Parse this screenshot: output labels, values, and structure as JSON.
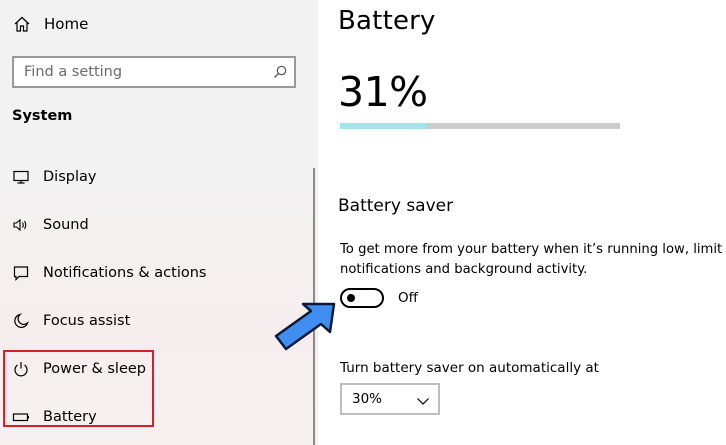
{
  "sidebar": {
    "home_label": "Home",
    "search_placeholder": "Find a setting",
    "section_title": "System",
    "items": [
      {
        "label": "Display",
        "icon": "monitor-icon"
      },
      {
        "label": "Sound",
        "icon": "speaker-icon"
      },
      {
        "label": "Notifications & actions",
        "icon": "notification-icon"
      },
      {
        "label": "Focus assist",
        "icon": "moon-icon"
      },
      {
        "label": "Power & sleep",
        "icon": "power-icon"
      },
      {
        "label": "Battery",
        "icon": "battery-icon"
      }
    ],
    "highlight_color": "#d82020"
  },
  "main": {
    "title": "Battery",
    "percent_text": "31%",
    "percent_value": 31,
    "bar_fill_color": "#a3e4ea",
    "battery_saver": {
      "heading": "Battery saver",
      "description": "To get more from your battery when it’s running low, limit notifications and background activity.",
      "toggle_state": "Off",
      "toggle_on": false
    },
    "auto": {
      "label": "Turn battery saver on automatically at",
      "selected": "30%"
    },
    "arrow_color": "#3f8ef0"
  }
}
